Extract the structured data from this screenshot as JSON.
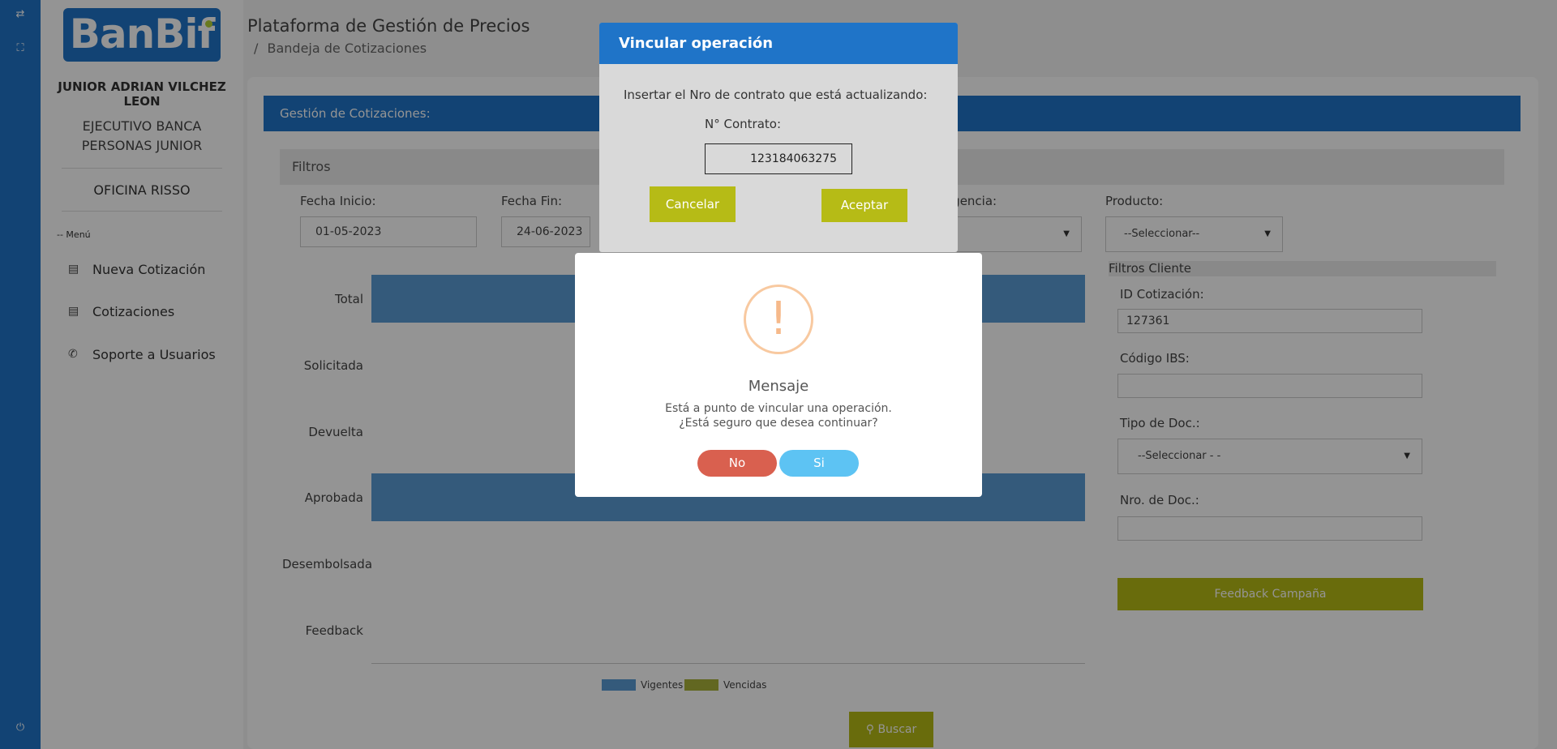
{
  "rail": {
    "icons": [
      "swap-icon",
      "fullscreen-icon",
      "power-icon"
    ]
  },
  "sidebar": {
    "logo": "BanBif",
    "user_name": "JUNIOR ADRIAN VILCHEZ LEON",
    "role": "EJECUTIVO BANCA PERSONAS JUNIOR",
    "office": "OFICINA RISSO",
    "menu_title": "-- Menú",
    "items": [
      {
        "label": "Nueva Cotización",
        "icon": "id-card-icon"
      },
      {
        "label": "Cotizaciones",
        "icon": "id-card-icon"
      },
      {
        "label": "Soporte a Usuarios",
        "icon": "phone-icon"
      }
    ]
  },
  "header": {
    "title": "Plataforma de Gestión de Precios",
    "breadcrumb_sep": "/",
    "breadcrumb": "Bandeja de Cotizaciones"
  },
  "main": {
    "card_title": "Gestión de Cotizaciones:",
    "filters_title": "Filtros",
    "fecha_inicio_label": "Fecha Inicio:",
    "fecha_inicio": "01-05-2023",
    "fecha_fin_label": "Fecha Fin:",
    "fecha_fin": "24-06-2023",
    "vigencia_label": "igencia:",
    "producto_label": "Producto:",
    "producto_value": "--Seleccionar--",
    "filtros_cliente": "Filtros Cliente",
    "id_cotizacion_label": "ID Cotización:",
    "id_cotizacion": "127361",
    "codigo_ibs_label": "Código IBS:",
    "codigo_ibs": "",
    "tipo_doc_label": "Tipo de Doc.:",
    "tipo_doc_value": "--Seleccionar - -",
    "nro_doc_label": "Nro. de Doc.:",
    "nro_doc": "",
    "feedback_btn": "Feedback Campaña",
    "buscar_btn": "Buscar"
  },
  "chart_data": {
    "type": "bar",
    "orientation": "horizontal",
    "categories": [
      "Total",
      "Solicitada",
      "Devuelta",
      "Aprobada",
      "Desembolsada",
      "Feedback"
    ],
    "series": [
      {
        "name": "Vigentes",
        "color": "#5b9bd5",
        "values": [
          1,
          0,
          0,
          1,
          0,
          0
        ]
      },
      {
        "name": "Vencidas",
        "color": "#a9b13a",
        "values": [
          0,
          0,
          0,
          0,
          0,
          0
        ]
      }
    ],
    "legend_placement": "bottom"
  },
  "vincular_modal": {
    "title": "Vincular operación",
    "text": "Insertar el Nro de contrato que está actualizando:",
    "contrato_label": "N° Contrato:",
    "contrato_value": "123184063275",
    "cancel": "Cancelar",
    "accept": "Aceptar"
  },
  "message_modal": {
    "icon_glyph": "!",
    "title": "Mensaje",
    "line1": "Está a punto de vincular una operación.",
    "line2": "¿Está seguro que desea continuar?",
    "no": "No",
    "yes": "Si",
    "no_color": "#d9604f",
    "yes_color": "#5dc3f3"
  }
}
